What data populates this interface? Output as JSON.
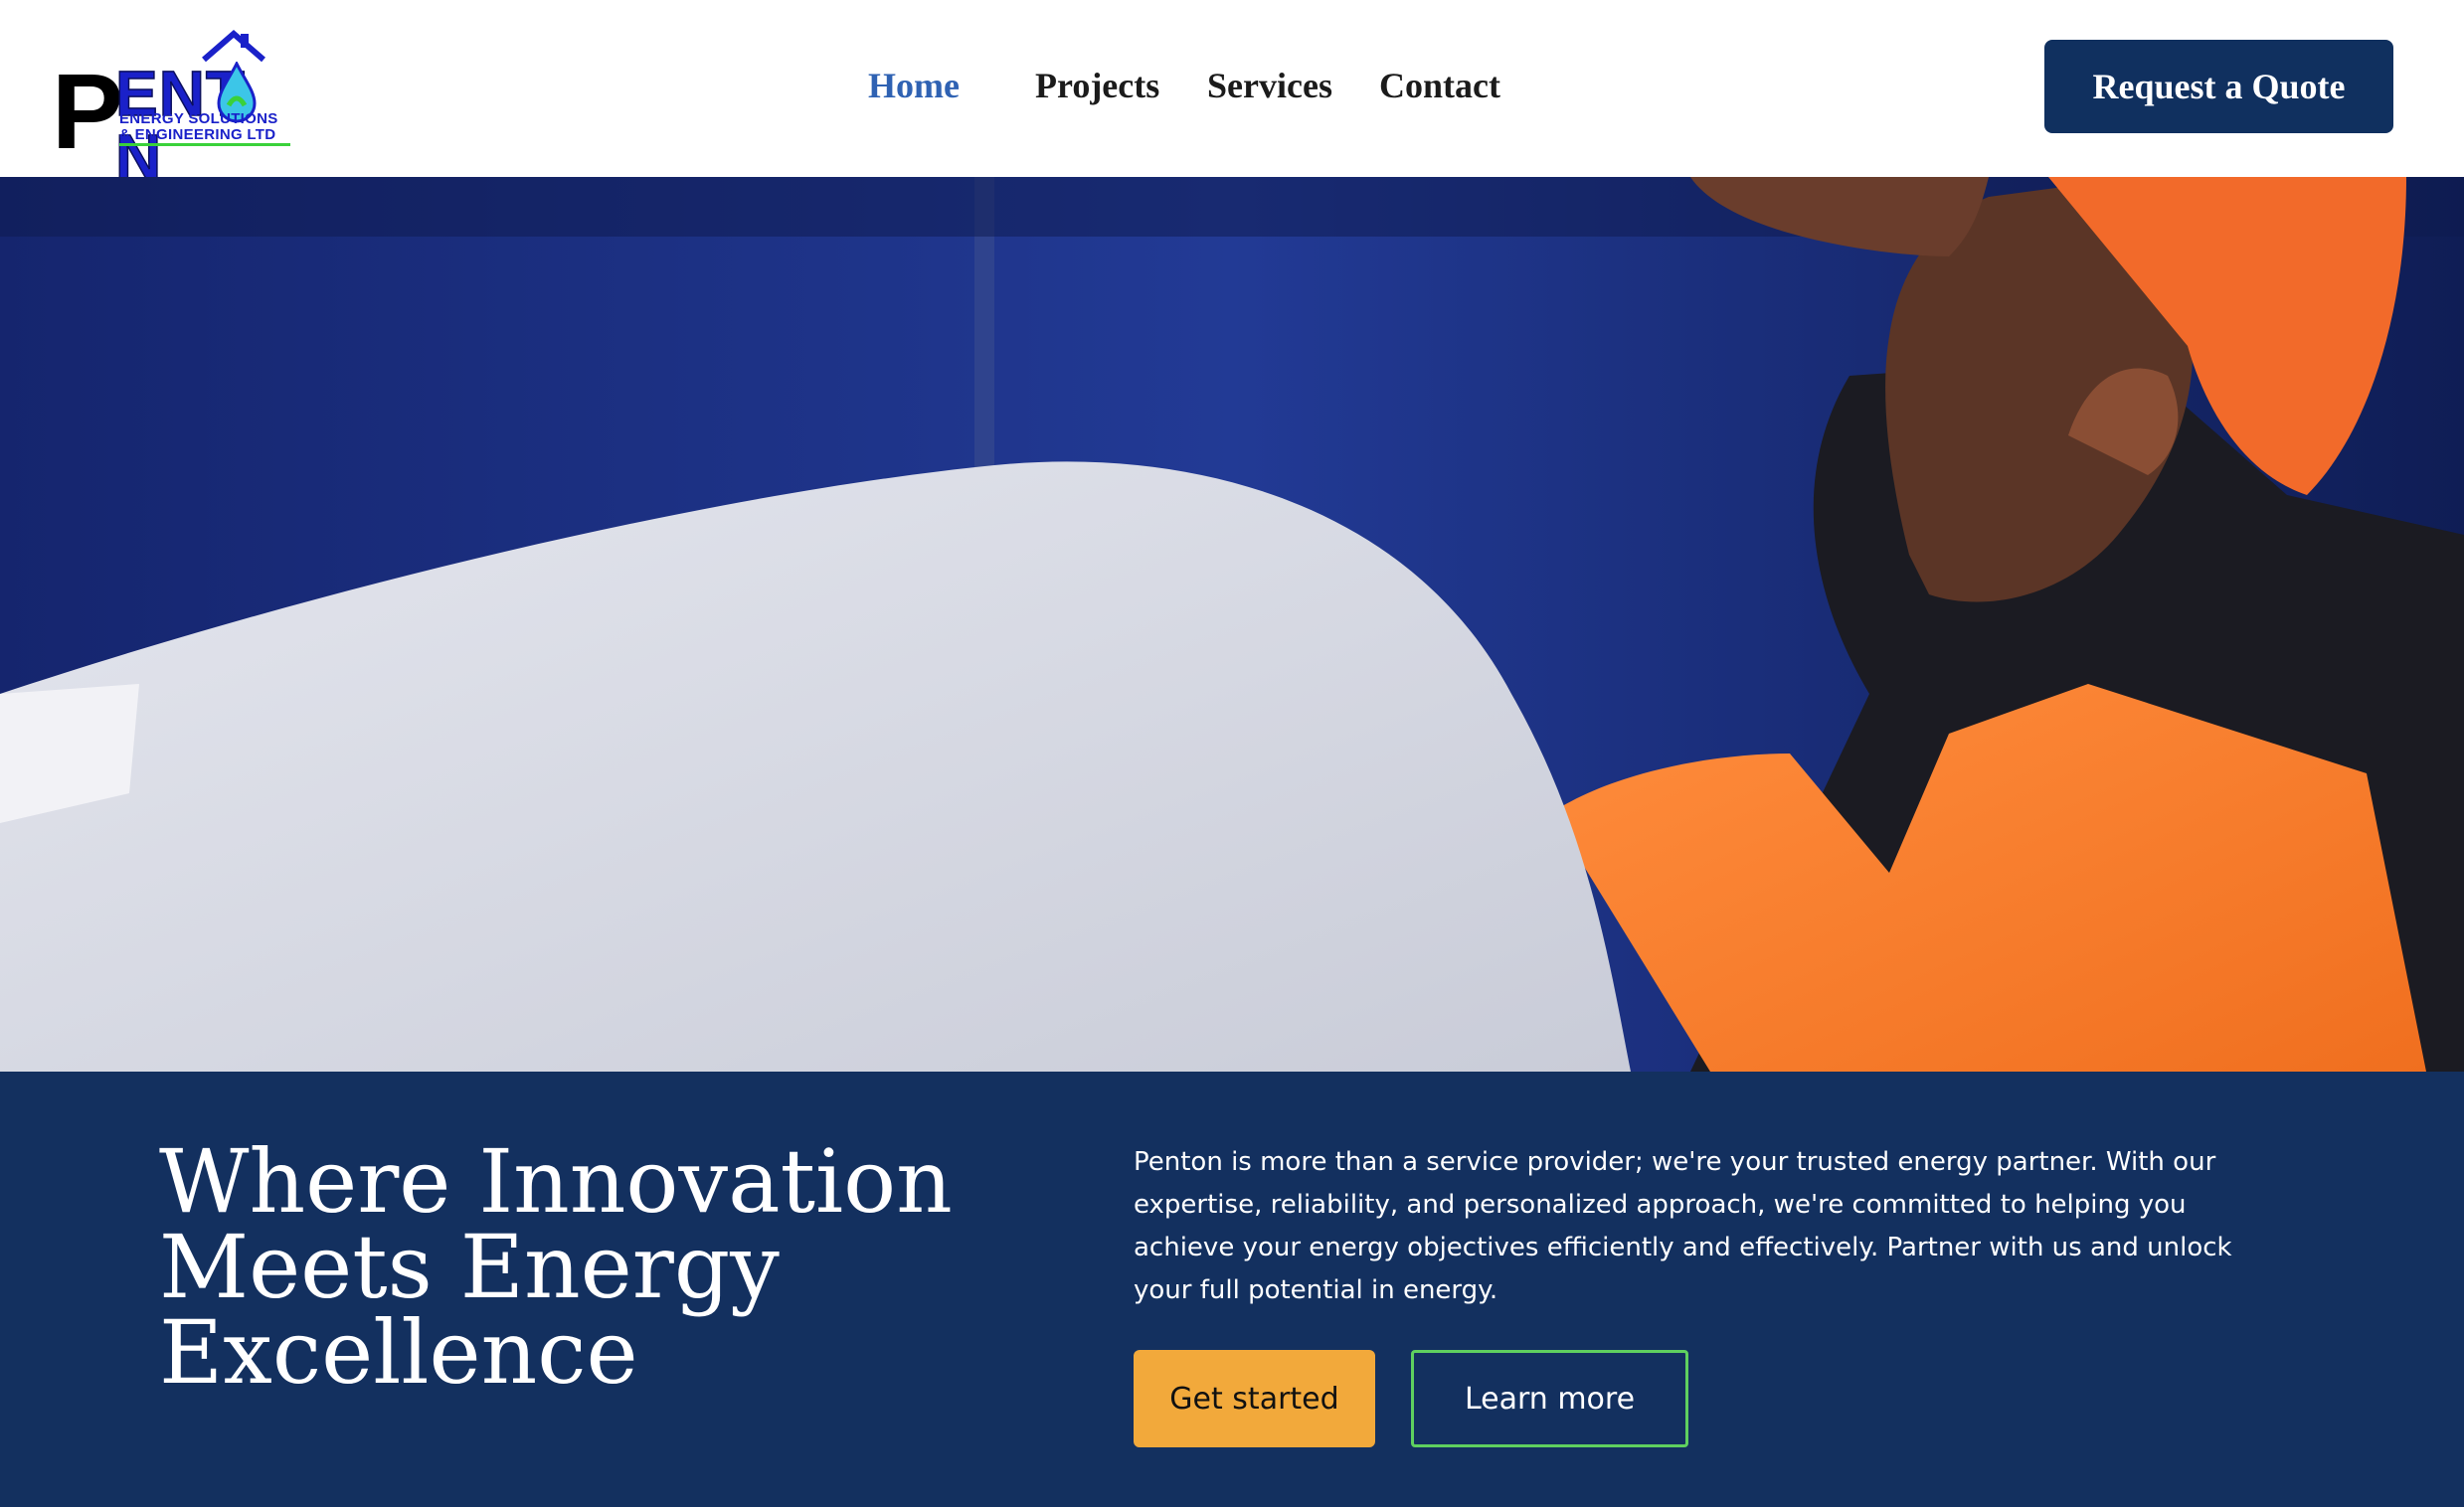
{
  "brand": {
    "logo_letter": "P",
    "logo_wordmark": "ENT N",
    "logo_line1": "ENERGY SOLUTIONS",
    "logo_line2": "& ENGINEERING LTD"
  },
  "nav": {
    "items": [
      {
        "label": "Home",
        "active": true
      },
      {
        "label": "Projects",
        "active": false
      },
      {
        "label": "Services",
        "active": false
      },
      {
        "label": "Contact",
        "active": false
      }
    ],
    "cta_label": "Request a Quote"
  },
  "hero": {
    "headline": "Where Innovation Meets Energy Excellence",
    "blurb": "Penton is more than a service provider; we're your trusted energy partner. With our expertise, reliability, and personalized approach, we're committed to helping you achieve your energy objectives efficiently and effectively. Partner with us and unlock your full potential in energy.",
    "primary_button": "Get started",
    "secondary_button": "Learn more"
  },
  "colors": {
    "navy": "#13305f",
    "nav_active": "#2f62b3",
    "accent_orange": "#f2a93b",
    "accent_green": "#5fd05f",
    "logo_blue": "#1a21c9"
  },
  "icons": {
    "logo": "penton-logo",
    "house": "house-roof-icon",
    "drop": "water-drop-icon"
  }
}
